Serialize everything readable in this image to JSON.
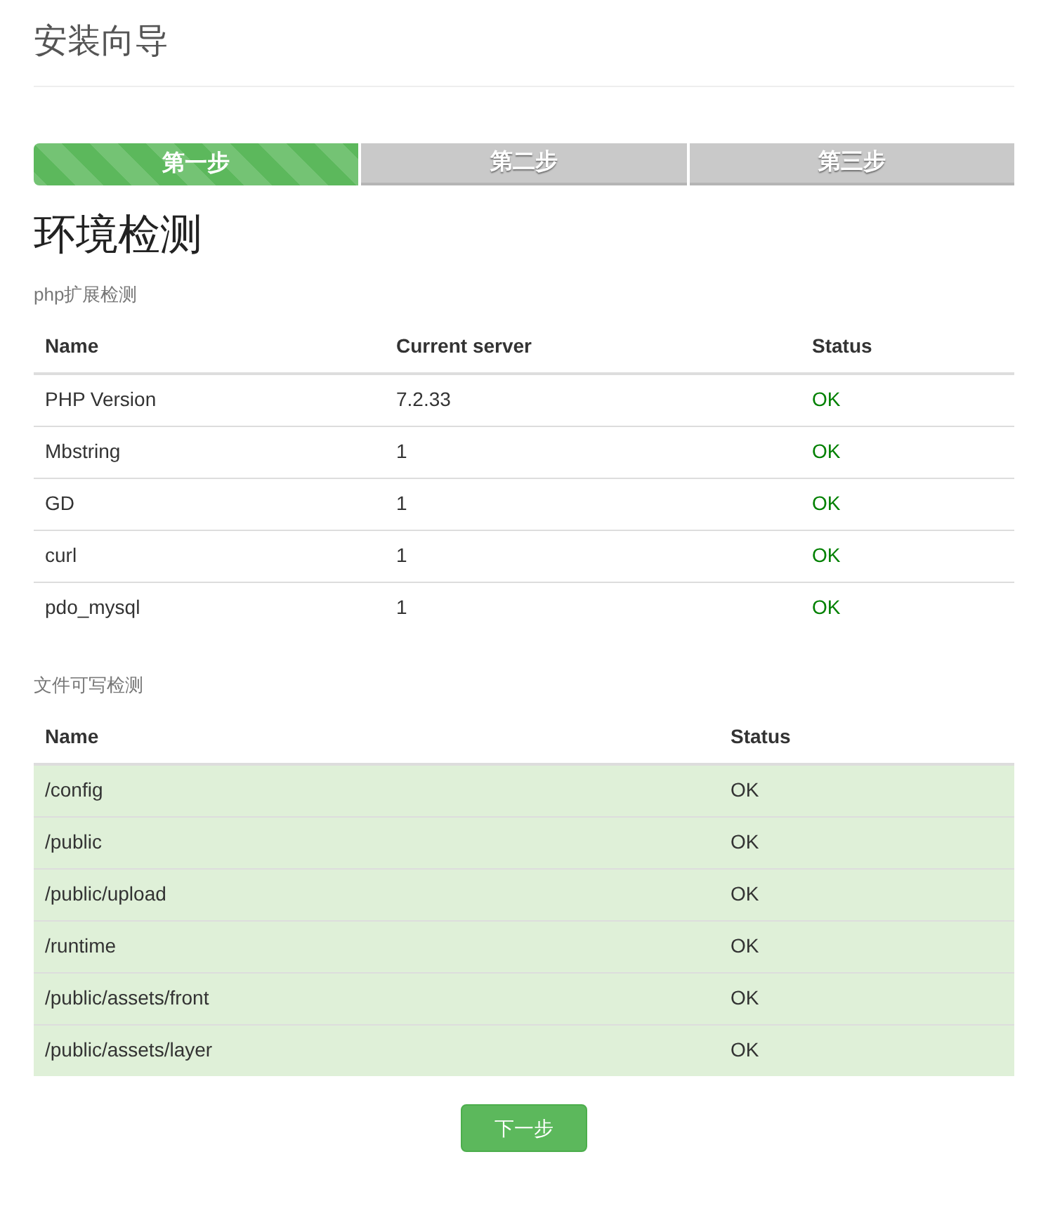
{
  "title": "安装向导",
  "steps": [
    {
      "label": "第一步",
      "selected": true
    },
    {
      "label": "第二步",
      "selected": false
    },
    {
      "label": "第三步",
      "selected": false
    }
  ],
  "heading": "环境检测",
  "extensions": {
    "caption": "php扩展检测",
    "columns": [
      "Name",
      "Current server",
      "Status"
    ],
    "rows": [
      {
        "name": "PHP Version",
        "value": "7.2.33",
        "status": "OK",
        "passed": true
      },
      {
        "name": "Mbstring",
        "value": "1",
        "status": "OK",
        "passed": true
      },
      {
        "name": "GD",
        "value": "1",
        "status": "OK",
        "passed": true
      },
      {
        "name": "curl",
        "value": "1",
        "status": "OK",
        "passed": true
      },
      {
        "name": "pdo_mysql",
        "value": "1",
        "status": "OK",
        "passed": true
      }
    ]
  },
  "files": {
    "caption": "文件可写检测",
    "columns": [
      "Name",
      "Status"
    ],
    "rows": [
      {
        "name": "/config",
        "status": "OK",
        "passed": true
      },
      {
        "name": "/public",
        "status": "OK",
        "passed": true
      },
      {
        "name": "/public/upload",
        "status": "OK",
        "passed": true
      },
      {
        "name": "/runtime",
        "status": "OK",
        "passed": true
      },
      {
        "name": "/public/assets/front",
        "status": "OK",
        "passed": true
      },
      {
        "name": "/public/assets/layer",
        "status": "OK",
        "passed": true
      }
    ]
  },
  "next_button": "下一步"
}
